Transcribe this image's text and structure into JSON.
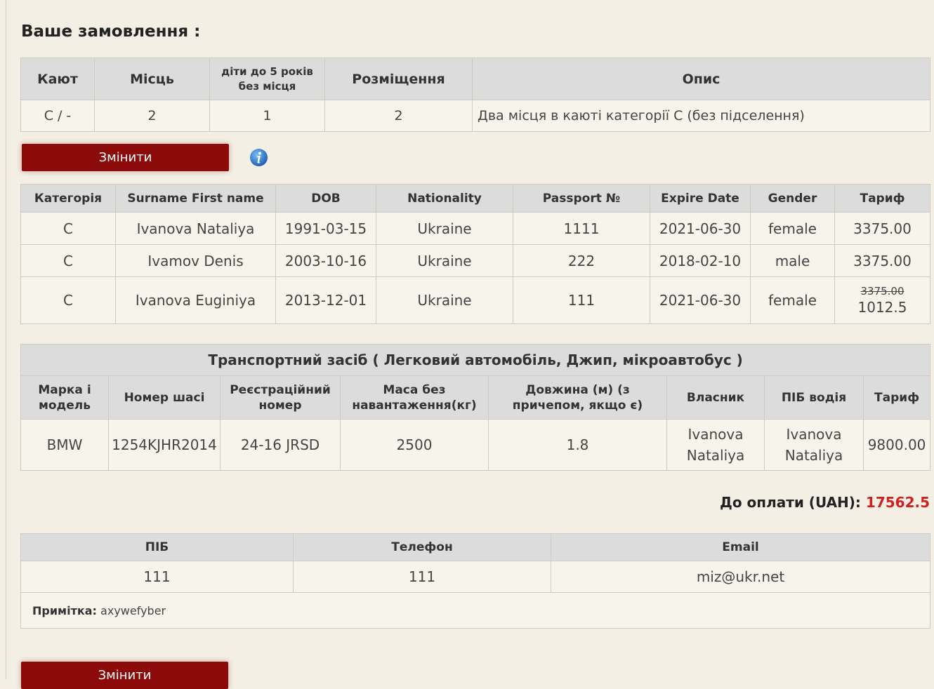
{
  "title": "Ваше замовлення :",
  "order": {
    "headers": [
      "Кают",
      "Місць",
      "діти до 5 років без місця",
      "Розміщення",
      "Опис"
    ],
    "row": [
      "C / -",
      "2",
      "1",
      "2",
      "Два місця в каюті категорії C (без підселення)"
    ]
  },
  "change_label": "Змінити",
  "info_icon": "info-icon",
  "passengers": {
    "headers": [
      "Категорія",
      "Surname First name",
      "DOB",
      "Nationality",
      "Passport №",
      "Expire Date",
      "Gender",
      "Тариф"
    ],
    "rows": [
      [
        "C",
        "Ivanova Nataliya",
        "1991-03-15",
        "Ukraine",
        "1111",
        "2021-06-30",
        "female",
        "3375.00"
      ],
      [
        "C",
        "Ivamov Denis",
        "2003-10-16",
        "Ukraine",
        "222",
        "2018-02-10",
        "male",
        "3375.00"
      ],
      [
        "C",
        "Ivanova Euginiya",
        "2013-12-01",
        "Ukraine",
        "111",
        "2021-06-30",
        "female"
      ]
    ],
    "row3_price_old": "3375.00",
    "row3_price_new": "1012.5"
  },
  "vehicle": {
    "caption": "Транспортний засіб ( Легковий автомобіль, Джип, мікроавтобус )",
    "headers": [
      "Марка і модель",
      "Номер шасі",
      "Реєстраційний номер",
      "Маса без навантаження(кг)",
      "Довжина (м) (з причепом, якщо є)",
      "Власник",
      "ПІБ водія",
      "Тариф"
    ],
    "row": [
      "BMW",
      "1254KJHR2014",
      "24-16 JRSD",
      "2500",
      "1.8",
      "Ivanova Nataliya",
      "Ivanova Nataliya",
      "9800.00"
    ]
  },
  "total": {
    "label": "До оплати (UAH):",
    "amount": "17562.5"
  },
  "contact": {
    "headers": [
      "ПІБ",
      "Телефон",
      "Email"
    ],
    "row": [
      "111",
      "111",
      "miz@ukr.net"
    ],
    "note_label": "Примітка:",
    "note_value": "axywefyber"
  },
  "colors": {
    "button": "#8c0a0a",
    "total_amount": "#d02020",
    "header_bg": "#dcdcdc",
    "page_bg": "#f3efe4"
  }
}
